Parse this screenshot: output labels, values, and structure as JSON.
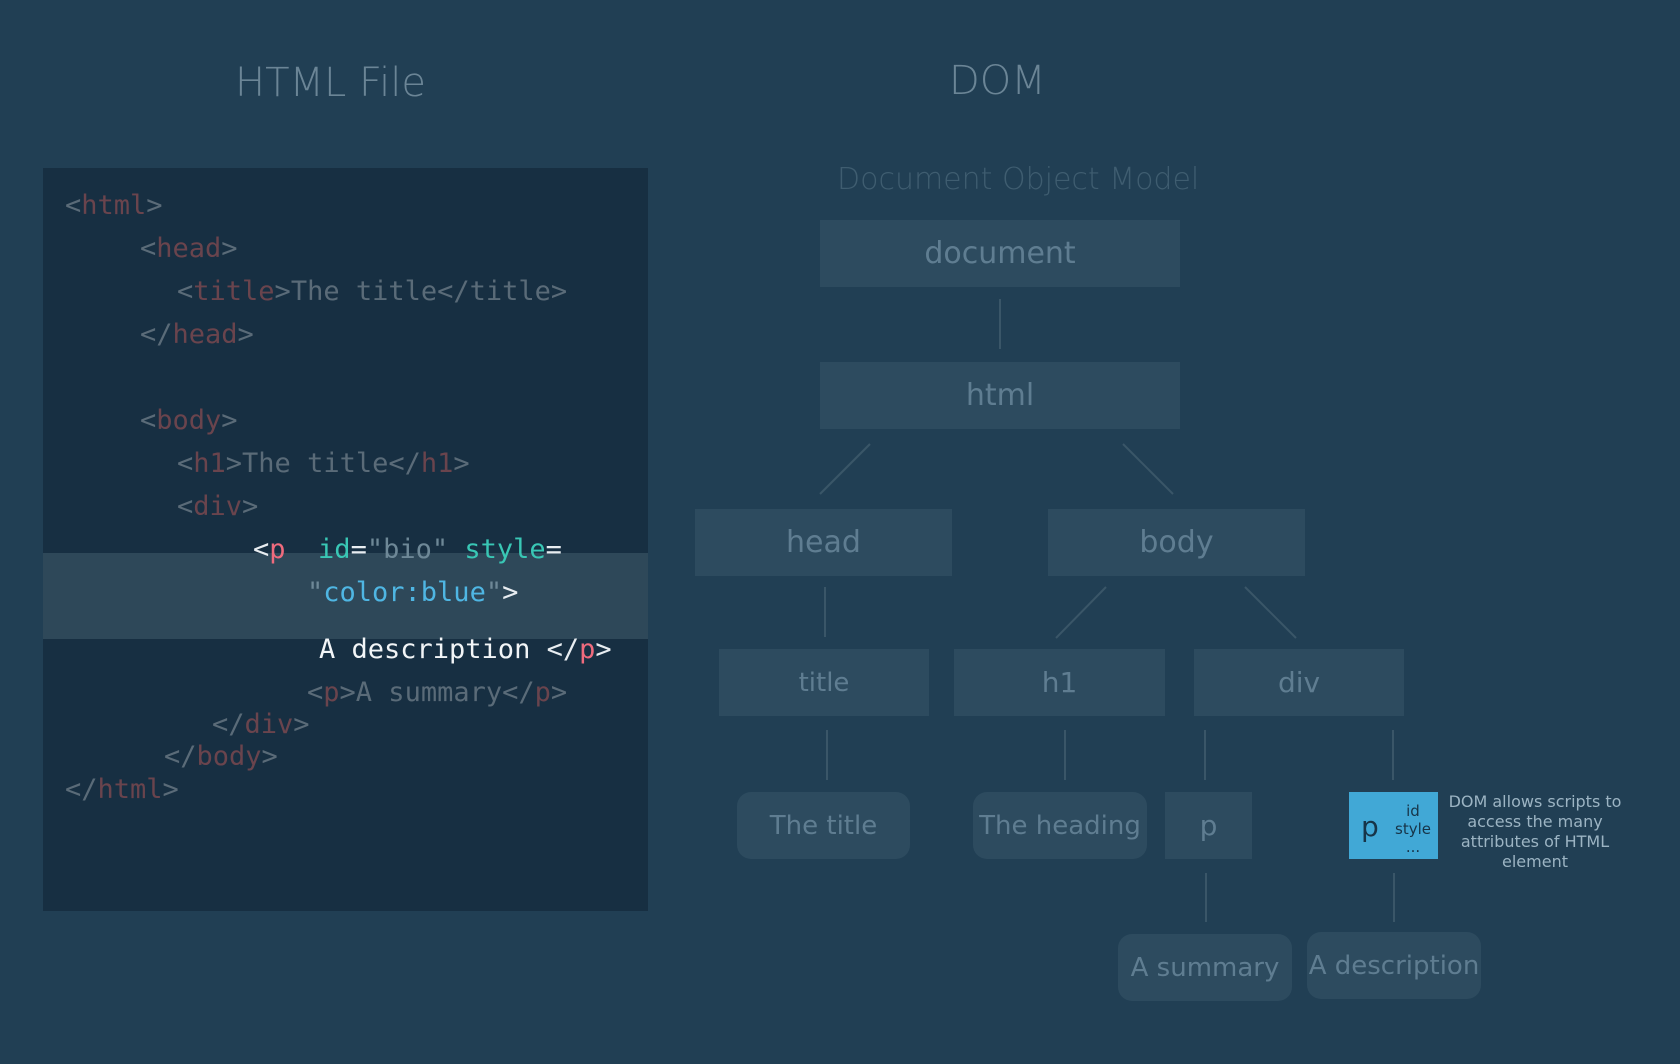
{
  "headings": {
    "html_file": "HTML File",
    "dom": "DOM",
    "dom_subtitle": "Document Object Model"
  },
  "code": {
    "lines": [
      [
        {
          "c": "br",
          "t": "<"
        },
        {
          "c": "tag",
          "t": "html"
        },
        {
          "c": "br",
          "t": ">"
        }
      ],
      [
        {
          "c": "br",
          "t": "<"
        },
        {
          "c": "tag",
          "t": "head"
        },
        {
          "c": "br",
          "t": ">"
        }
      ],
      [
        {
          "c": "br",
          "t": "<"
        },
        {
          "c": "tag",
          "t": "title"
        },
        {
          "c": "br",
          "t": ">"
        },
        {
          "c": "text",
          "t": "The title"
        },
        {
          "c": "br",
          "t": "</title>"
        }
      ],
      [
        {
          "c": "br",
          "t": "</"
        },
        {
          "c": "tag",
          "t": "head"
        },
        {
          "c": "br",
          "t": ">"
        }
      ],
      [
        {
          "c": "br",
          "t": "<"
        },
        {
          "c": "tag",
          "t": "body"
        },
        {
          "c": "br",
          "t": ">"
        }
      ],
      [
        {
          "c": "br",
          "t": "<"
        },
        {
          "c": "tag",
          "t": "h1"
        },
        {
          "c": "br",
          "t": ">"
        },
        {
          "c": "text",
          "t": "The title"
        },
        {
          "c": "br",
          "t": "</"
        },
        {
          "c": "tag",
          "t": "h1"
        },
        {
          "c": "br",
          "t": ">"
        }
      ],
      [
        {
          "c": "br",
          "t": "<"
        },
        {
          "c": "tag",
          "t": "div"
        },
        {
          "c": "br",
          "t": ">"
        }
      ],
      [
        {
          "c": "br",
          "t": "<"
        },
        {
          "c": "tag",
          "t": "p"
        },
        {
          "c": "text",
          "t": "  "
        },
        {
          "c": "attr",
          "t": "id"
        },
        {
          "c": "eq",
          "t": "="
        },
        {
          "c": "q",
          "t": "\"bio\""
        },
        {
          "c": "text",
          "t": " "
        },
        {
          "c": "attr",
          "t": "style"
        },
        {
          "c": "eq",
          "t": "="
        }
      ],
      [
        {
          "c": "q",
          "t": "\""
        },
        {
          "c": "val",
          "t": "color:blue"
        },
        {
          "c": "q",
          "t": "\""
        },
        {
          "c": "br",
          "t": ">"
        }
      ],
      [
        {
          "c": "text",
          "t": "A description "
        },
        {
          "c": "br",
          "t": "</"
        },
        {
          "c": "tag",
          "t": "p"
        },
        {
          "c": "br",
          "t": ">"
        }
      ],
      [
        {
          "c": "br",
          "t": "<"
        },
        {
          "c": "tag",
          "t": "p"
        },
        {
          "c": "br",
          "t": ">"
        },
        {
          "c": "text",
          "t": "A summary"
        },
        {
          "c": "br",
          "t": "</"
        },
        {
          "c": "tag",
          "t": "p"
        },
        {
          "c": "br",
          "t": ">"
        }
      ],
      [
        {
          "c": "br",
          "t": "</"
        },
        {
          "c": "tag",
          "t": "div"
        },
        {
          "c": "br",
          "t": ">"
        }
      ],
      [
        {
          "c": "br",
          "t": "</"
        },
        {
          "c": "tag",
          "t": "body"
        },
        {
          "c": "br",
          "t": ">"
        }
      ],
      [
        {
          "c": "br",
          "t": "</"
        },
        {
          "c": "tag",
          "t": "html"
        },
        {
          "c": "br",
          "t": ">"
        }
      ]
    ]
  },
  "dom_tree": {
    "nodes": {
      "document": "document",
      "html": "html",
      "head": "head",
      "body": "body",
      "title": "title",
      "h1": "h1",
      "div": "div",
      "leaf_title": "The title",
      "leaf_heading": "The heading",
      "p_node": "p",
      "p_highlight": "p",
      "leaf_summary": "A summary",
      "leaf_description": "A description"
    },
    "p_attributes": [
      "id",
      "style",
      "..."
    ],
    "note": "DOM allows scripts to access the many attributes of HTML element"
  },
  "colors": {
    "background": "#213f54",
    "code_panel": "#172f42",
    "node": "#2d4b5f",
    "highlight_node": "#41a8d6",
    "tag_highlight": "#ef6b7d",
    "attr_highlight": "#39c7b5",
    "value_highlight": "#4fb6e3"
  }
}
